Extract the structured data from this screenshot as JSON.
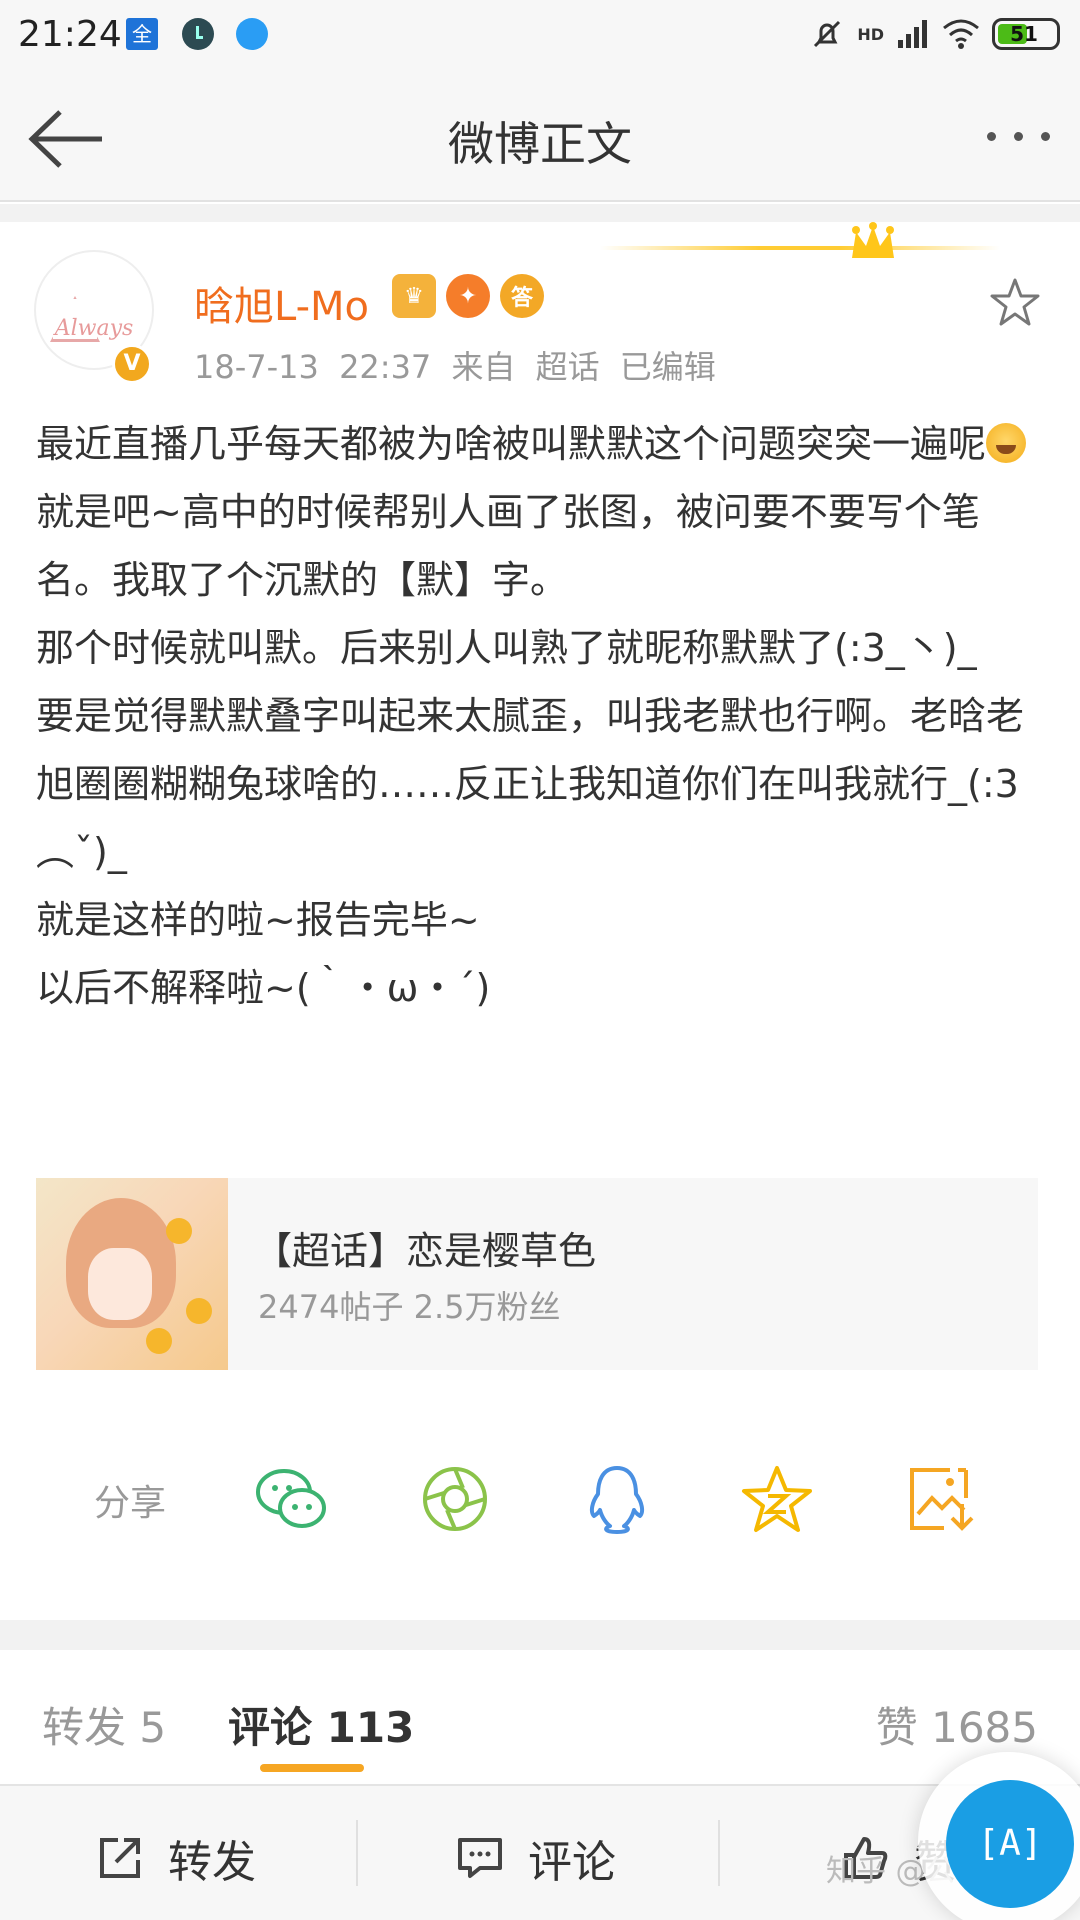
{
  "status_bar": {
    "time": "21:24",
    "quan_icon_text": "全",
    "network": "HD",
    "battery": "51",
    "battery_level": 0.51
  },
  "nav": {
    "title": "微博正文",
    "back_icon": "arrow-left-icon",
    "more_icon": "more-dots-icon"
  },
  "post": {
    "author": "晗旭L-Mo",
    "avatar_text": "Always",
    "verified_mark": "V",
    "badges": [
      "vip-crown-icon",
      "fire-bird-icon",
      "answer-badge-icon"
    ],
    "answer_badge_text": "答",
    "meta": "18-7-13 22:37  来自 超话  已编辑",
    "body_lines": [
      "最近直播几乎每天都被为啥被叫默默这个问题突突一遍呢",
      "就是吧~高中的时候帮别人画了张图，被问要不要写个笔名。我取了个沉默的【默】字。",
      "那个时候就叫默。后来别人叫熟了就昵称默默了(:3_丶)_",
      "要是觉得默默叠字叫起来太腻歪，叫我老默也行啊。老晗老旭圈圈糊糊兔球啥的……反正让我知道你们在叫我就行_(:3︵ˇ)_",
      "就是这样的啦~报告完毕~",
      "以后不解释啦~(｀・ω・´)"
    ]
  },
  "topic": {
    "title": "【超话】恋是樱草色",
    "stats": "2474帖子 2.5万粉丝"
  },
  "share": {
    "label": "分享",
    "icons": [
      "wechat-icon",
      "moments-icon",
      "qq-icon",
      "qzone-icon",
      "save-image-icon"
    ],
    "colors": {
      "wechat": "#3cb371",
      "moments": "#8bc34a",
      "qq": "#4a90e2",
      "qzone": "#f5b800",
      "save": "#f5a623"
    }
  },
  "tabs": {
    "repost": "转发 5",
    "comment": "评论 113",
    "like": "赞 1685"
  },
  "bottom_bar": {
    "repost": "转发",
    "comment": "评论",
    "like": "赞"
  },
  "watermark": "知乎 @公子扶苏",
  "fab_label": "[A]",
  "colors": {
    "accent": "#f06d1e",
    "tab_underline": "#f6a623",
    "fab": "#1a9ee4"
  }
}
